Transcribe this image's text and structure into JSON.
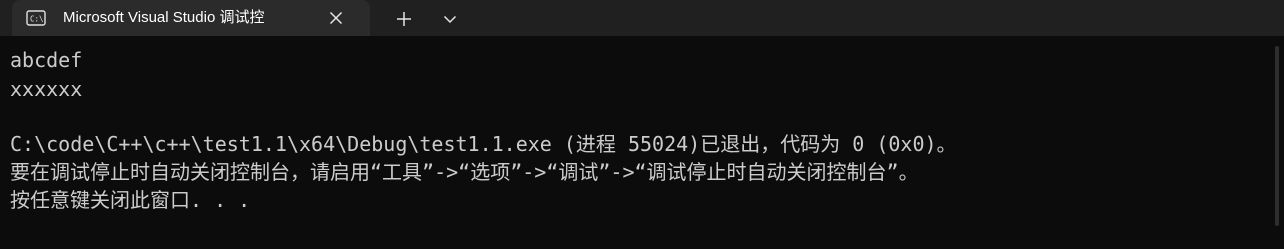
{
  "tab": {
    "title": "Microsoft Visual Studio 调试控",
    "icon": "terminal-icon"
  },
  "controls": {
    "close_icon": "close-icon",
    "new_tab_icon": "plus-icon",
    "dropdown_icon": "chevron-down-icon"
  },
  "terminal": {
    "lines": [
      "abcdef",
      "xxxxxx",
      "",
      "C:\\code\\C++\\c++\\test1.1\\x64\\Debug\\test1.1.exe (进程 55024)已退出，代码为 0 (0x0)。",
      "要在调试停止时自动关闭控制台，请启用“工具”->“选项”->“调试”->“调试停止时自动关闭控制台”。",
      "按任意键关闭此窗口. . ."
    ]
  },
  "colors": {
    "background": "#0c0c0c",
    "tabbar": "#202020",
    "active_tab": "#2b2b2b",
    "text": "#cccccc"
  }
}
